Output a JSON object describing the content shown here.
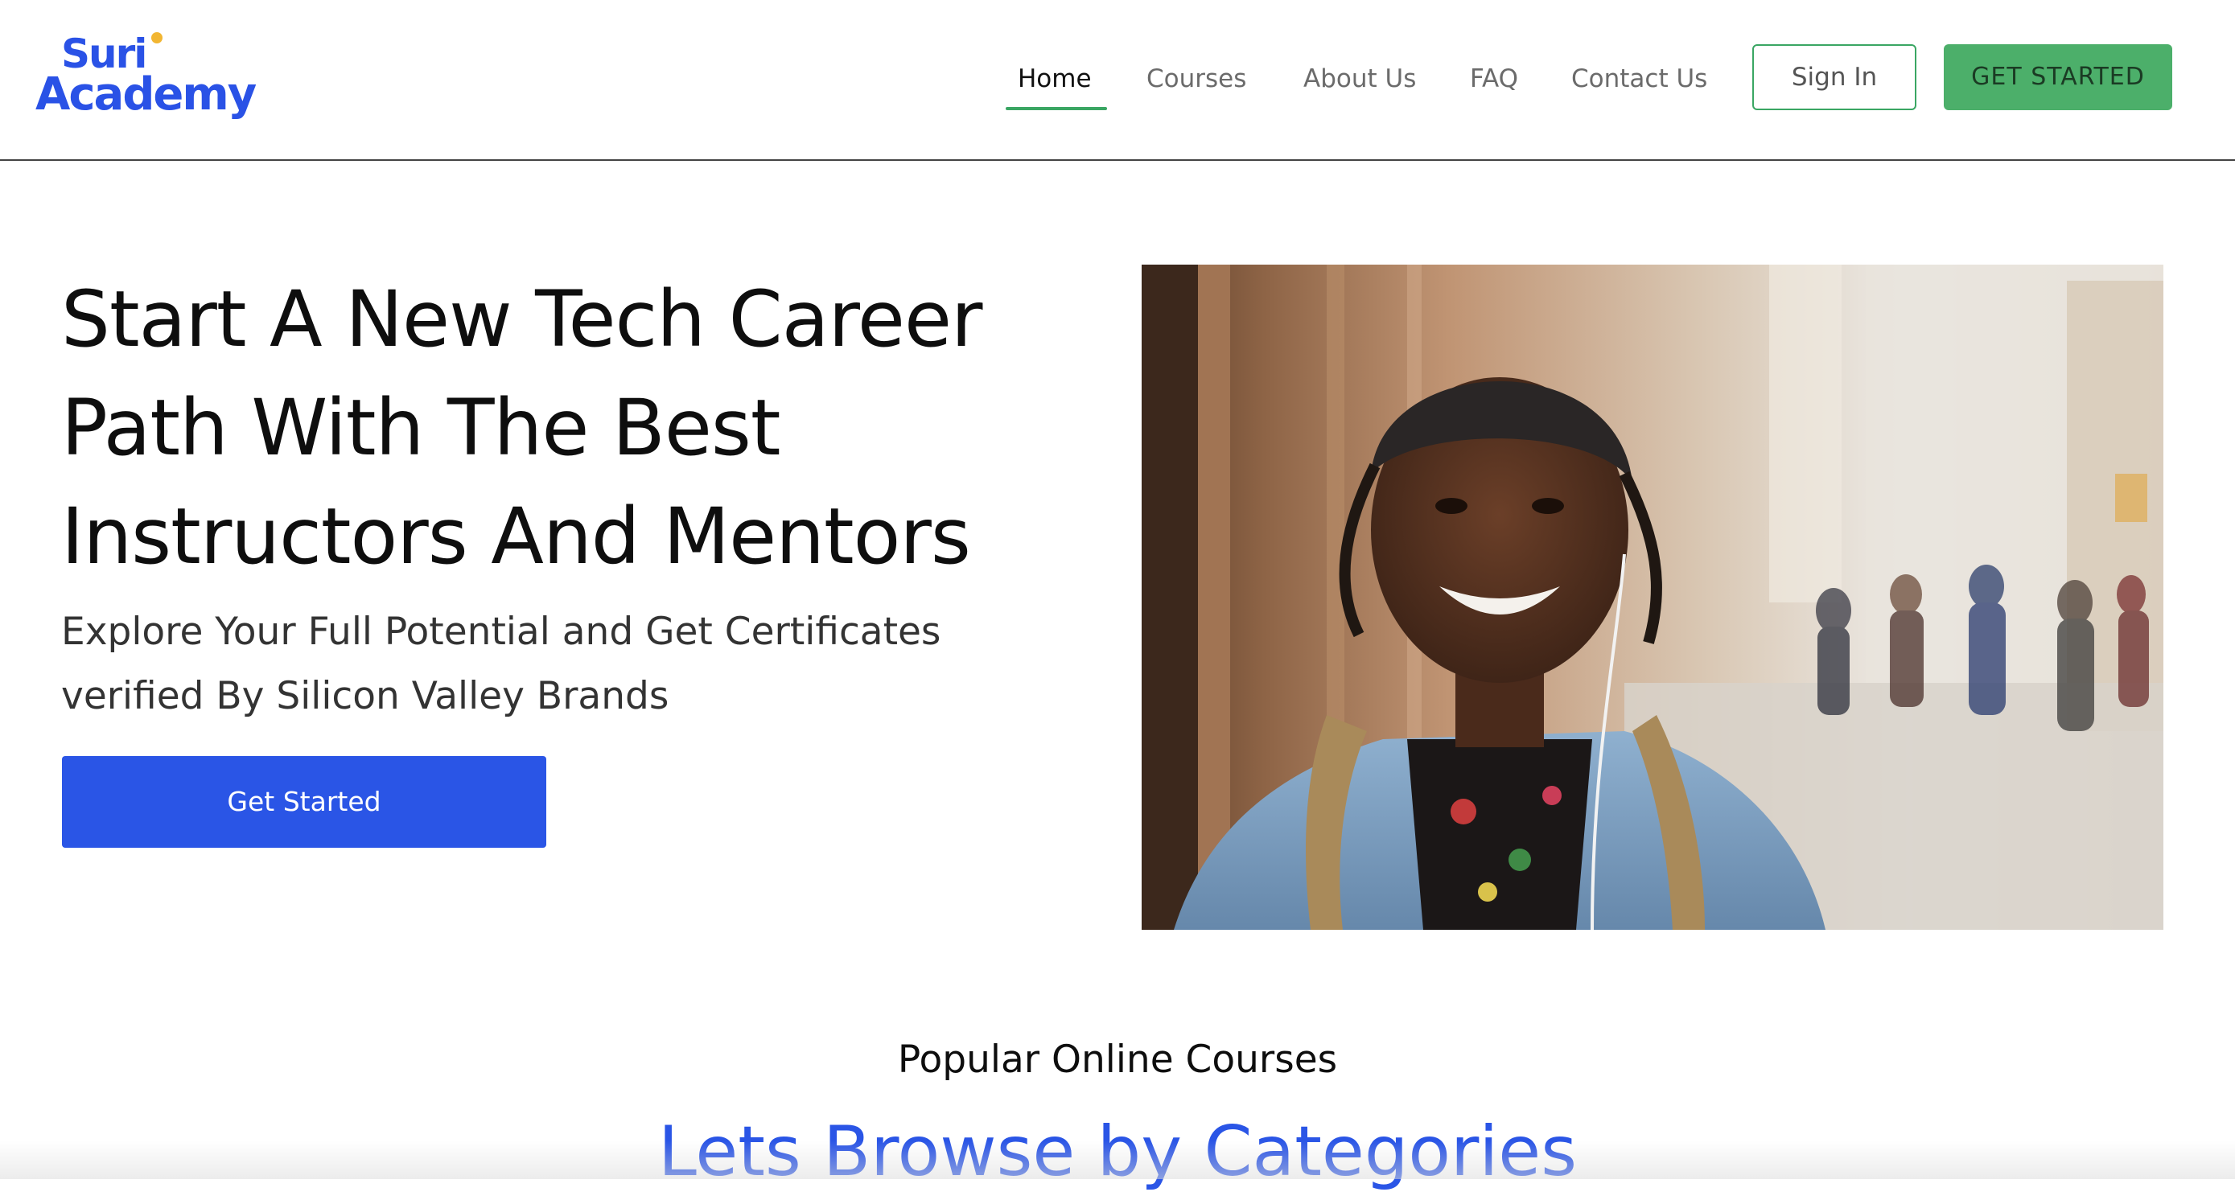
{
  "brand": {
    "logo_line1": "Suri",
    "logo_line2": "Academy",
    "accent_color": "#2a55e6",
    "green_color": "#4caf6a",
    "dot_color": "#f2b632"
  },
  "nav": {
    "items": [
      {
        "label": "Home",
        "active": true
      },
      {
        "label": "Courses",
        "active": false
      },
      {
        "label": "About Us",
        "active": false
      },
      {
        "label": "FAQ",
        "active": false
      },
      {
        "label": "Contact Us",
        "active": false
      }
    ],
    "sign_in_label": "Sign In",
    "get_started_label": "GET STARTED"
  },
  "hero": {
    "title_lines": [
      "Start A New Tech Career",
      "Path With The Best",
      "Instructors And Mentors"
    ],
    "subtitle_lines": [
      "Explore Your Full Potential and Get Certificates",
      "verified By Silicon Valley Brands"
    ],
    "cta_label": "Get Started",
    "image_icon": "smiling-student-photo"
  },
  "section": {
    "kicker": "Popular Online Courses",
    "title": "Lets Browse by Categories"
  }
}
